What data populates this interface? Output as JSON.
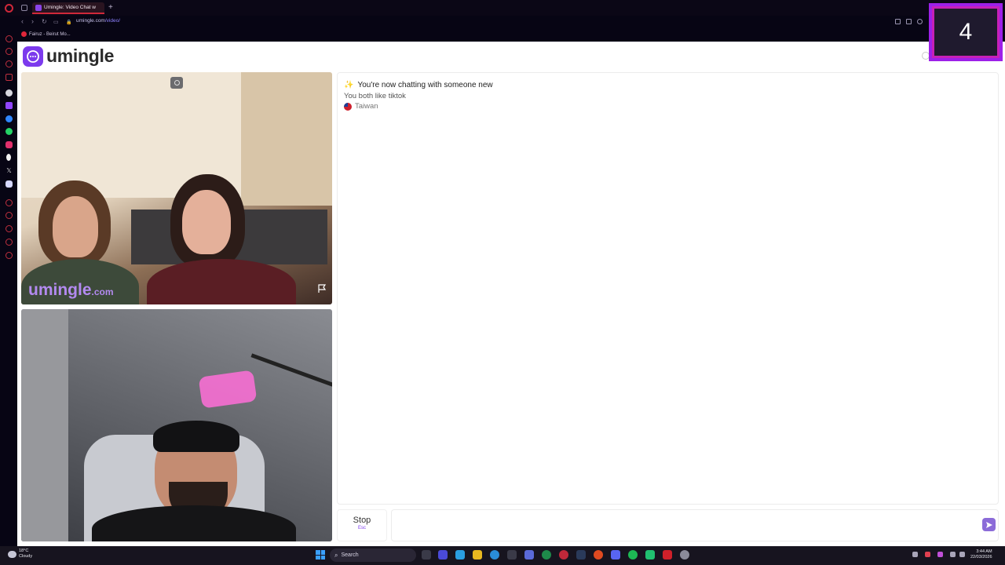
{
  "browser": {
    "tab_title": "Umingle: Video Chat w",
    "url_host": "umingle.com",
    "url_path": "/video/",
    "bookmark_label": "Fairuz - Beirut Mo..."
  },
  "page": {
    "logo_text": "umingle",
    "watermark": "umingle",
    "watermark_suffix": ".com",
    "chat": {
      "status_line": "You're now chatting with someone new",
      "common_interest": "You both like tiktok",
      "country": "Taiwan"
    },
    "stop_button": {
      "label": "Stop",
      "shortcut": "Esc"
    },
    "chat_input": {
      "value": "",
      "placeholder": ""
    }
  },
  "overlay": {
    "counter": "4"
  },
  "taskbar": {
    "weather_temp": "18°C",
    "weather_desc": "Cloudy",
    "search_label": "Search",
    "time": "3:44 AM",
    "date": "22/03/2026"
  },
  "colors": {
    "brand_purple": "#7c3aed",
    "opera_red": "#d0283a",
    "overlay_border": "#9d20e8"
  },
  "icons": [
    "opera-logo-icon",
    "back-icon",
    "forward-icon",
    "reload-icon",
    "send-icon",
    "flag-report-icon",
    "camera-icon",
    "windows-start-icon",
    "search-icon"
  ]
}
